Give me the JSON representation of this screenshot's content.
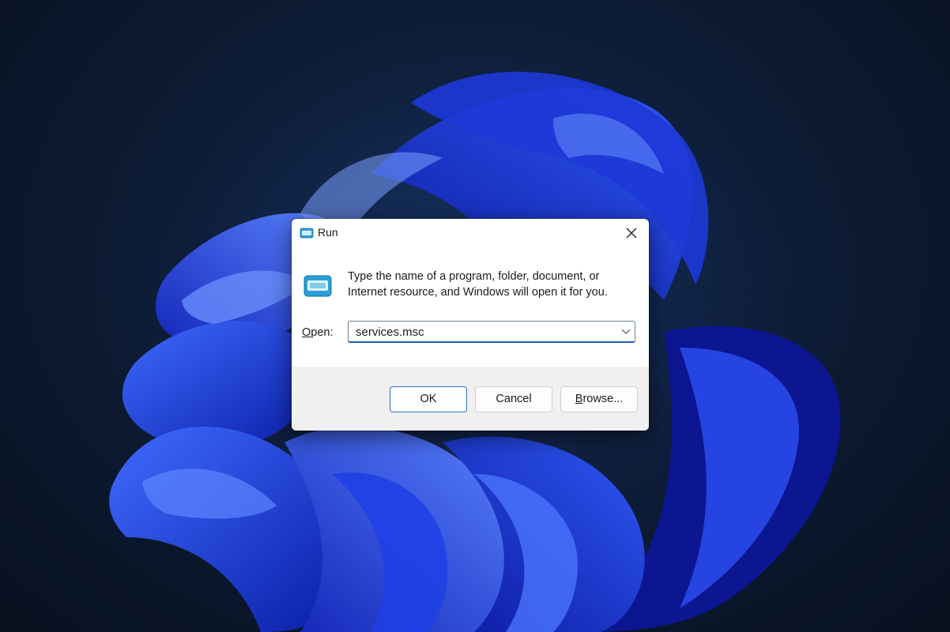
{
  "dialog": {
    "title": "Run",
    "description": "Type the name of a program, folder, document, or Internet resource, and Windows will open it for you.",
    "open_label_mnemonic": "O",
    "open_label_rest": "pen:",
    "open_value": "services.msc",
    "buttons": {
      "ok": "OK",
      "cancel": "Cancel",
      "browse_mnemonic": "B",
      "browse_rest": "rowse..."
    }
  },
  "icons": {
    "title": "run-icon",
    "close": "close-icon",
    "dropdown": "chevron-down-icon"
  },
  "colors": {
    "accent": "#1a5fb4",
    "icon_cyan": "#2aa0d8",
    "wallpaper_blue": "#1f3fe0"
  }
}
